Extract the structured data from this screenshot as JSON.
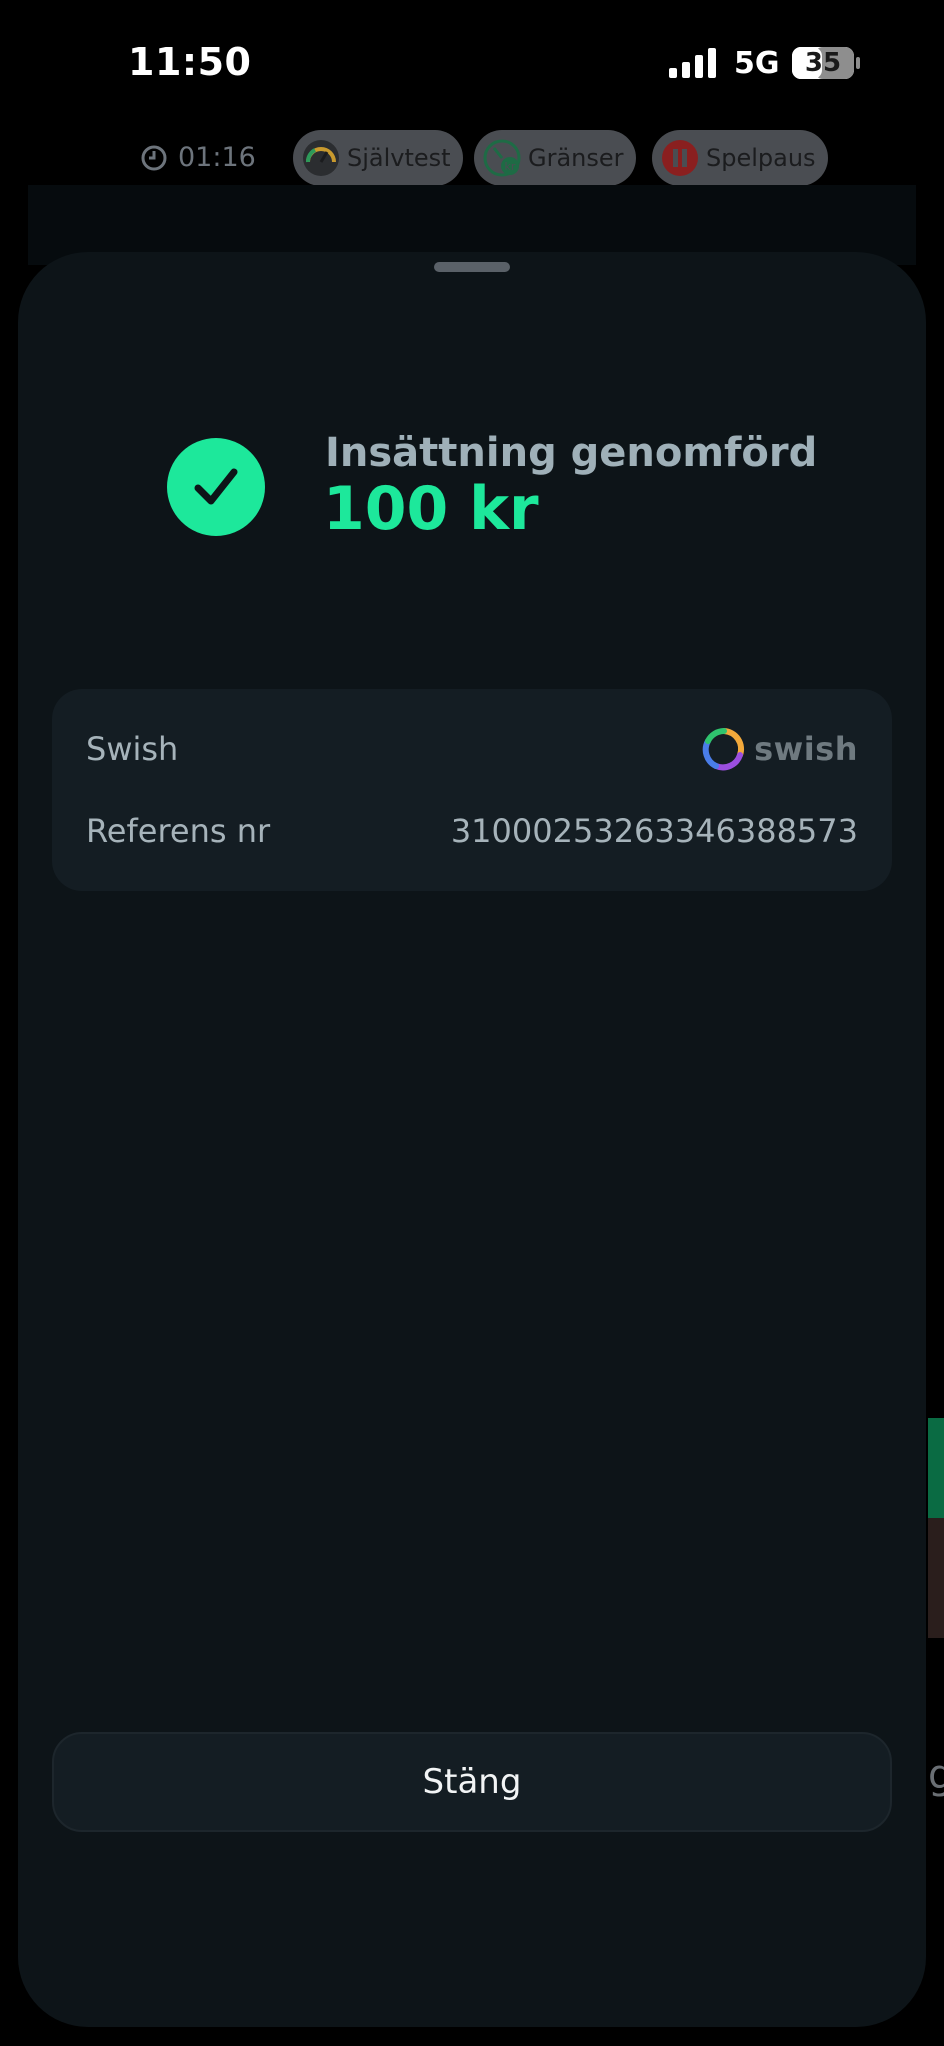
{
  "status_bar": {
    "time": "11:50",
    "network": "5G",
    "battery": "35"
  },
  "toolbar": {
    "session_time": "01:16",
    "pills": [
      {
        "label": "Självtest",
        "icon": "gauge-icon"
      },
      {
        "label": "Gränser",
        "icon": "limits-icon"
      },
      {
        "label": "Spelpaus",
        "icon": "pause-icon"
      }
    ]
  },
  "sheet": {
    "title": "Insättning genomförd",
    "amount": "100 kr",
    "details": {
      "method_label": "Swish",
      "method_logo": "swish",
      "reference_label": "Referens nr",
      "reference_value": "3100025326334638857​3"
    },
    "close_label": "Stäng"
  },
  "colors": {
    "accent": "#1de89b",
    "sheet_bg": "#0d1418",
    "card_bg": "#141d23"
  }
}
